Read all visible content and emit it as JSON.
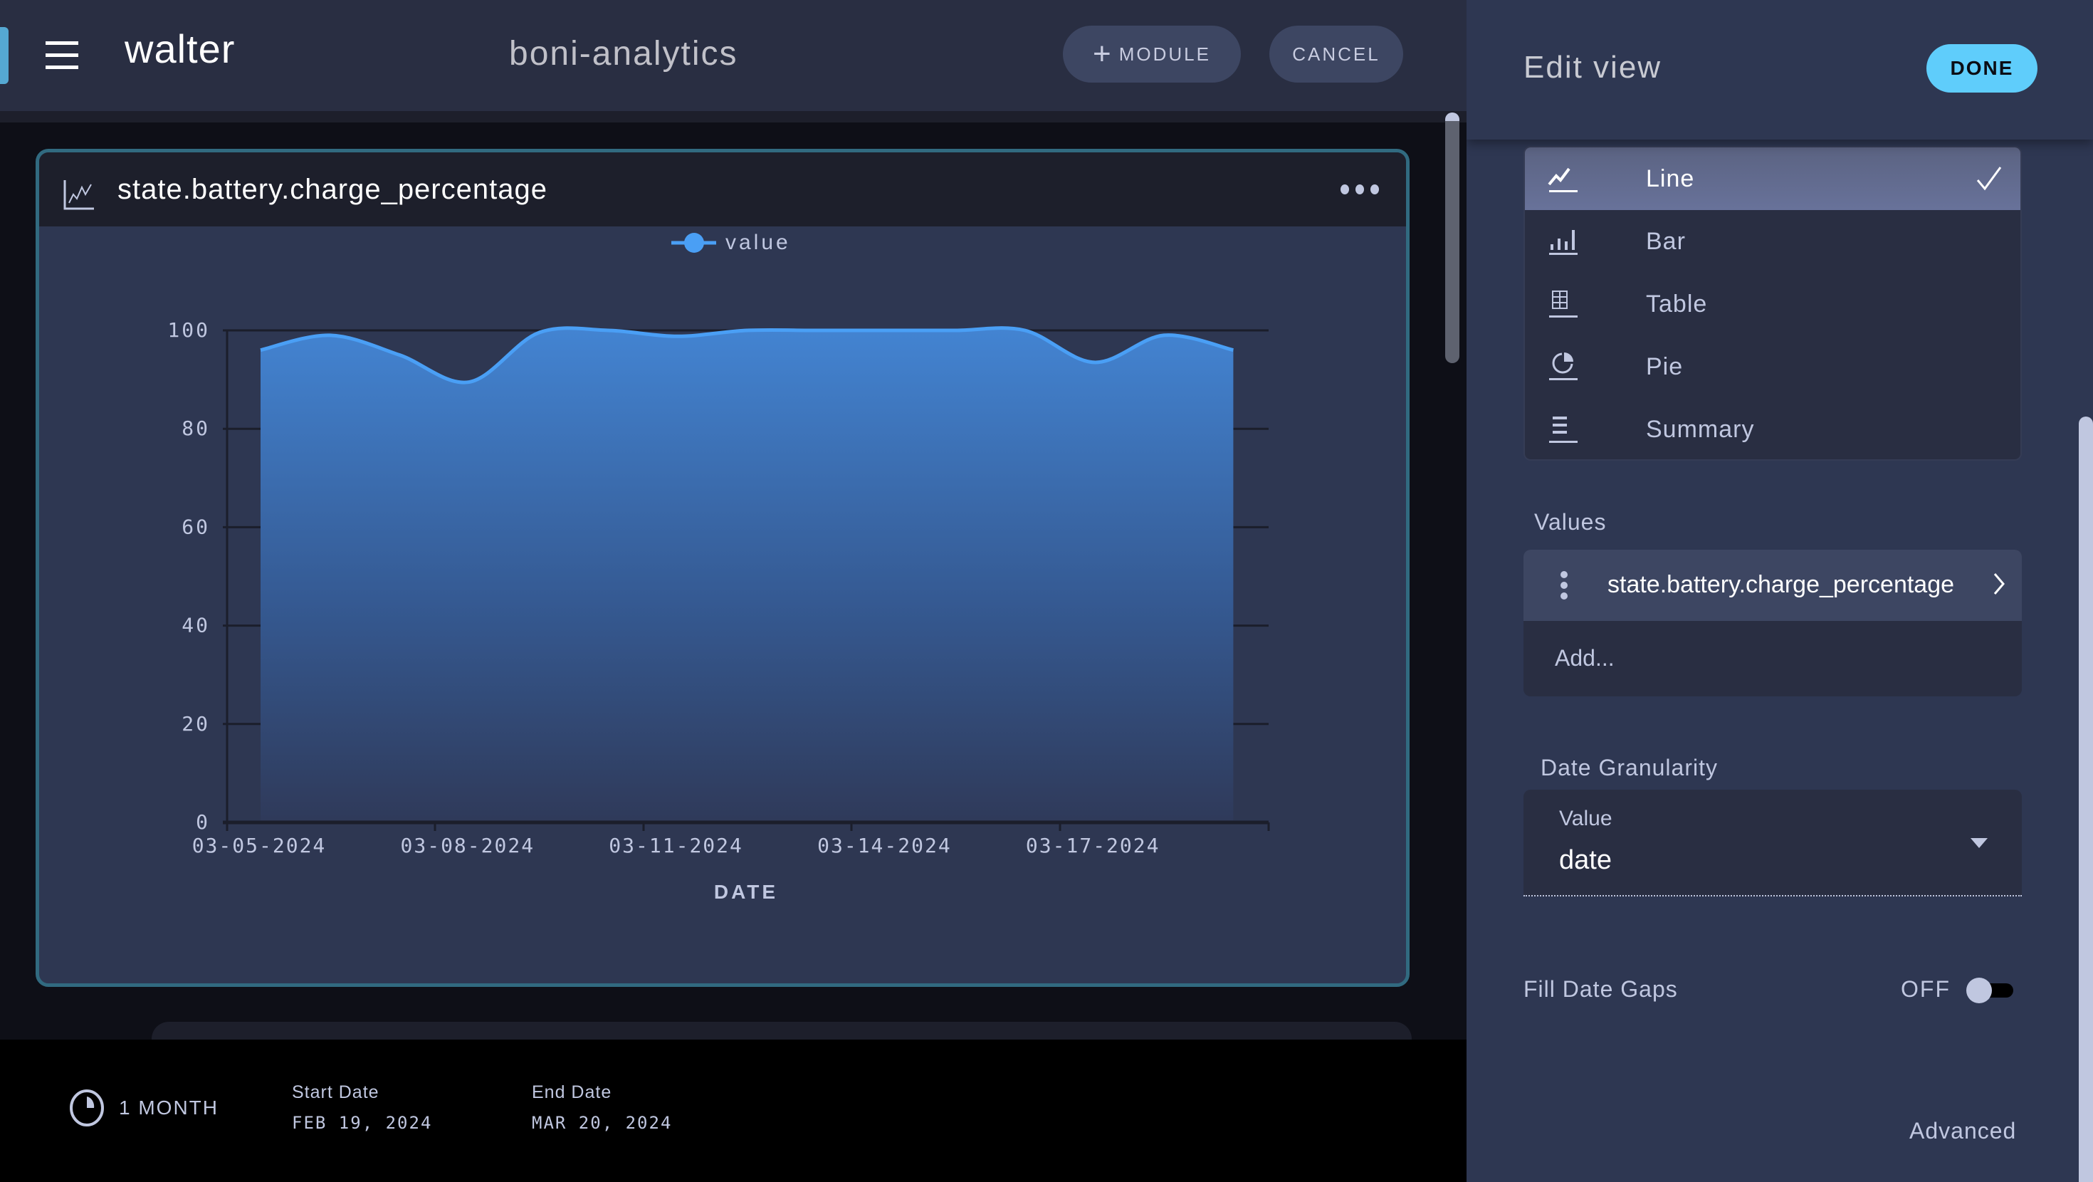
{
  "header": {
    "app_name": "walter",
    "dashboard_name": "boni-analytics",
    "module_button": "MODULE",
    "cancel_button": "CANCEL"
  },
  "card": {
    "title": "state.battery.charge_percentage",
    "icon": "line-chart-icon",
    "menu_icon": "more-horizontal-icon"
  },
  "chart_data": {
    "type": "area",
    "title": "",
    "legend": [
      "value"
    ],
    "legend_position": "top-center",
    "xlabel": "DATE",
    "ylabel": "",
    "ylim": [
      0,
      100
    ],
    "yticks": [
      0,
      20,
      40,
      60,
      80,
      100
    ],
    "grid": true,
    "x_tick_labels": [
      "03-05-2024",
      "03-08-2024",
      "03-11-2024",
      "03-14-2024",
      "03-17-2024"
    ],
    "x": [
      "03-05-2024",
      "03-06-2024",
      "03-07-2024",
      "03-08-2024",
      "03-09-2024",
      "03-10-2024",
      "03-11-2024",
      "03-12-2024",
      "03-13-2024",
      "03-14-2024",
      "03-15-2024",
      "03-16-2024",
      "03-17-2024",
      "03-18-2024",
      "03-19-2024"
    ],
    "series": [
      {
        "name": "value",
        "color": "#4a9ff5",
        "values": [
          96,
          99,
          95,
          89.5,
          99.5,
          100,
          98.8,
          100,
          100,
          100,
          100,
          100,
          93.5,
          99,
          96
        ]
      }
    ]
  },
  "footer": {
    "range_label": "1 MONTH",
    "start_caption": "Start Date",
    "start_value": "FEB 19, 2024",
    "end_caption": "End Date",
    "end_value": "MAR 20, 2024"
  },
  "panel": {
    "title": "Edit view",
    "done_button": "DONE",
    "chart_types": [
      {
        "label": "Line",
        "icon": "line-chart-icon",
        "selected": true
      },
      {
        "label": "Bar",
        "icon": "bar-chart-icon",
        "selected": false
      },
      {
        "label": "Table",
        "icon": "table-icon",
        "selected": false
      },
      {
        "label": "Pie",
        "icon": "pie-chart-icon",
        "selected": false
      },
      {
        "label": "Summary",
        "icon": "summary-icon",
        "selected": false
      }
    ],
    "values_label": "Values",
    "values": [
      "state.battery.charge_percentage"
    ],
    "add_placeholder": "Add...",
    "date_granularity_label": "Date Granularity",
    "date_granularity_caption": "Value",
    "date_granularity_value": "date",
    "fill_date_gaps_label": "Fill Date Gaps",
    "fill_date_gaps_state": "OFF",
    "advanced_link": "Advanced"
  },
  "colors": {
    "accent": "#5fcdfb",
    "series": "#4a9ff5",
    "card_border": "#316a80"
  }
}
